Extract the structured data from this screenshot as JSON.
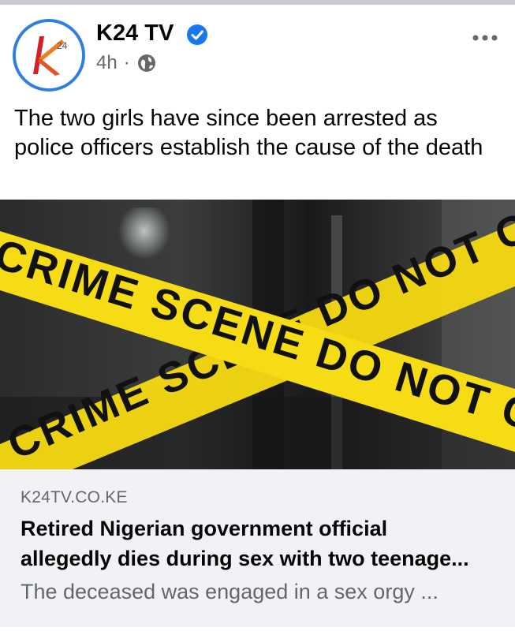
{
  "post": {
    "page_name": "K24 TV",
    "logo_text": "K",
    "logo_sub": "24",
    "timestamp": "4h",
    "separator": "·",
    "audience_icon": "globe-icon",
    "verified_icon": "verified-badge-icon",
    "more_icon": "more-options-icon",
    "caption": "The two girls have since been arrested as police officers establish the cause of the death"
  },
  "link": {
    "image_text": {
      "tape_top": "CRIME SCENE DO NOT CR",
      "tape_bottom": "CRIME SCENE DO NOT CR"
    },
    "domain": "K24TV.CO.KE",
    "headline_line1": "Retired Nigerian government official",
    "headline_line2": "allegedly dies during sex with two teenage...",
    "description": "The deceased was engaged in a sex orgy ..."
  },
  "colors": {
    "verified_blue": "#1877f2",
    "avatar_ring": "#2f7fe0",
    "logo_orange": "#f07e21",
    "logo_red": "#d32027",
    "tape_yellow": "#f4d812",
    "preview_bg": "#f0f2f5",
    "secondary_text": "#65676b"
  }
}
